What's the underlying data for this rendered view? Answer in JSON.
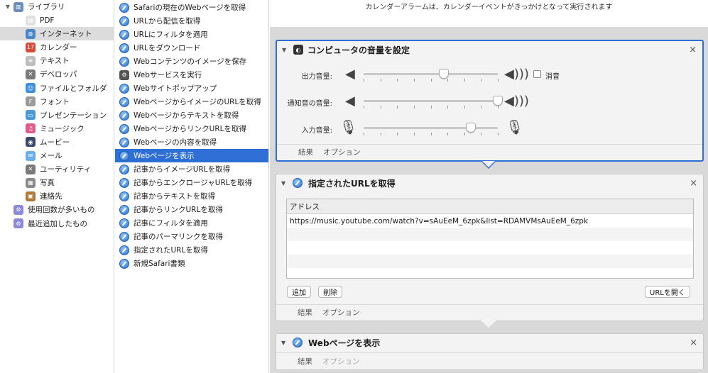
{
  "library": {
    "root_label": "ライブラリ",
    "items": [
      {
        "label": "PDF",
        "icon": "pdf-icon",
        "color": "#e0e0e0",
        "glyph": "▤"
      },
      {
        "label": "インターネット",
        "icon": "globe-icon",
        "color": "#4a86c8",
        "glyph": "◍",
        "selected": true
      },
      {
        "label": "カレンダー",
        "icon": "calendar-icon",
        "color": "#d84a3a",
        "glyph": "17"
      },
      {
        "label": "テキスト",
        "icon": "text-icon",
        "color": "#bdbdbd",
        "glyph": "≡"
      },
      {
        "label": "デベロッパ",
        "icon": "tools-icon",
        "color": "#7a7a7a",
        "glyph": "✕"
      },
      {
        "label": "ファイルとフォルダ",
        "icon": "finder-icon",
        "color": "#3d8fe0",
        "glyph": "☺"
      },
      {
        "label": "フォント",
        "icon": "font-icon",
        "color": "#9a9a9a",
        "glyph": "F"
      },
      {
        "label": "プレゼンテーション",
        "icon": "presentation-icon",
        "color": "#4a9ad8",
        "glyph": "▭"
      },
      {
        "label": "ミュージック",
        "icon": "music-icon",
        "color": "#e25b8c",
        "glyph": "♫"
      },
      {
        "label": "ムービー",
        "icon": "movie-icon",
        "color": "#3a4a6a",
        "glyph": "◉"
      },
      {
        "label": "メール",
        "icon": "mail-icon",
        "color": "#6aaee8",
        "glyph": "✉"
      },
      {
        "label": "ユーティリティ",
        "icon": "utility-icon",
        "color": "#7a7a7a",
        "glyph": "✕"
      },
      {
        "label": "写真",
        "icon": "photos-icon",
        "color": "#8a8a8a",
        "glyph": "▦"
      },
      {
        "label": "連絡先",
        "icon": "contacts-icon",
        "color": "#b07a3a",
        "glyph": "▣"
      }
    ],
    "smart": [
      {
        "label": "使用回数が多いもの",
        "icon": "smart-folder-icon"
      },
      {
        "label": "最近追加したもの",
        "icon": "smart-folder-icon"
      }
    ]
  },
  "actions": {
    "items": [
      "Safariの現在のWebページを取得",
      "URLから配信を取得",
      "URLにフィルタを適用",
      "URLをダウンロード",
      "Webコンテンツのイメージを保存",
      "Webサービスを実行",
      "Webサイトポップアップ",
      "WebページからイメージのURLを取得",
      "Webページからテキストを取得",
      "WebページからリンクURLを取得",
      "Webページの内容を取得",
      "Webページを表示",
      "記事からイメージURLを取得",
      "記事からエンクロージャURLを取得",
      "記事からテキストを取得",
      "記事からリンクURLを取得",
      "記事にフィルタを適用",
      "記事のパーマリンクを取得",
      "指定されたURLを取得",
      "新規Safari書類"
    ],
    "selected_index": 11,
    "web_service_index": 5
  },
  "workflow": {
    "hint": "カレンダーアラームは、カレンダーイベントがきっかけとなって実行されます",
    "volume_card": {
      "title": "コンピュータの音量を設定",
      "output_label": "出力音量:",
      "alert_label": "通知音の音量:",
      "input_label": "入力音量:",
      "mute_label": "消音",
      "output_level": 0.6,
      "alert_level": 1.0,
      "input_level": 0.8,
      "footer_results": "結果",
      "footer_options": "オプション"
    },
    "url_card": {
      "title": "指定されたURLを取得",
      "column_header": "アドレス",
      "rows": [
        "https://music.youtube.com/watch?v=sAuEeM_6zpk&list=RDAMVMsAuEeM_6zpk"
      ],
      "add_button": "追加",
      "delete_button": "削除",
      "open_button": "URLを開く",
      "footer_results": "結果",
      "footer_options": "オプション"
    },
    "web_card": {
      "title": "Webページを表示",
      "footer_results": "結果",
      "footer_options": "オプション"
    },
    "accent_color": "#2e6fd6"
  }
}
